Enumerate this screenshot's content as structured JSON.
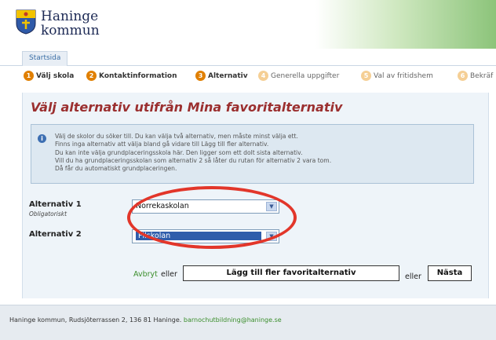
{
  "header": {
    "logo_line1": "Haninge",
    "logo_line2": "kommun"
  },
  "tabs": [
    {
      "label": "Startsida"
    }
  ],
  "steps": [
    {
      "num": "1",
      "label": "Välj skola",
      "state": "done"
    },
    {
      "num": "2",
      "label": "Kontaktinformation",
      "state": "done"
    },
    {
      "num": "3",
      "label": "Alternativ",
      "state": "current"
    },
    {
      "num": "4",
      "label": "Generella uppgifter",
      "state": "todo"
    },
    {
      "num": "5",
      "label": "Val av fritidshem",
      "state": "todo"
    },
    {
      "num": "6",
      "label": "Bekräf",
      "state": "todo"
    }
  ],
  "panel": {
    "title": "Välj alternativ utifrån Mina favoritalternativ",
    "info_icon": "info-icon",
    "info_lines": [
      "Välj de skolor du söker till. Du kan välja två alternativ, men måste minst välja ett.",
      "Finns inga alternativ att välja bland gå vidare till Lägg till fler alternativ.",
      "Du kan inte välja grundplaceringsskola här. Den ligger som ett dolt sista alternativ.",
      "Vill du ha grundplaceringsskolan som alternativ 2 så låter du rutan för alternativ 2 vara tom.",
      "Då får du automatiskt grundplaceringen."
    ]
  },
  "form": {
    "alt1_label": "Alternativ 1",
    "alt1_sub": "Obligatoriskt",
    "alt1_value": "Norrekaskolan",
    "alt2_label": "Alternativ 2",
    "alt2_value": "Pilskolan"
  },
  "actions": {
    "cancel": "Avbryt",
    "or1": "eller",
    "add_more": "Lägg till fler favoritalternativ",
    "or2": "eller",
    "next": "Nästa"
  },
  "footer": {
    "address": "Haninge kommun, Rudsjöterrassen 2, 136 81 Haninge.",
    "email": "barnochutbildning@haninge.se"
  },
  "colors": {
    "accent_orange": "#e07f00",
    "title_red": "#9b2f2f",
    "highlight_ring": "#e2362a",
    "link_green": "#3b8e2c"
  }
}
